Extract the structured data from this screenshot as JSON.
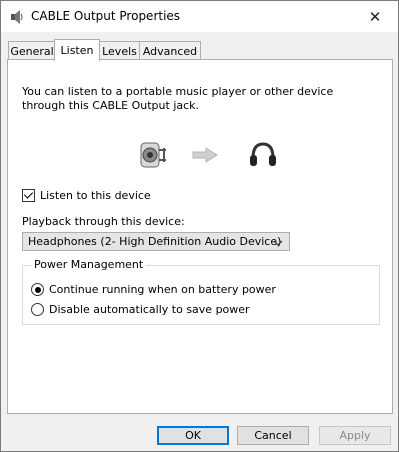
{
  "window": {
    "title": "CABLE Output Properties"
  },
  "tabs": [
    {
      "label": "General",
      "active": false
    },
    {
      "label": "Listen",
      "active": true
    },
    {
      "label": "Levels",
      "active": false
    },
    {
      "label": "Advanced",
      "active": false
    }
  ],
  "listen": {
    "description": "You can listen to a portable music player or other device through this CABLE Output jack.",
    "checkbox_label": "Listen to this device",
    "checkbox_checked": true,
    "playback_label": "Playback through this device:",
    "playback_selected": "Headphones (2- High Definition Audio Device)"
  },
  "power": {
    "title": "Power Management",
    "option_continue": "Continue running when on battery power",
    "option_disable": "Disable automatically to save power",
    "selected": "continue"
  },
  "buttons": {
    "ok": "OK",
    "cancel": "Cancel",
    "apply": "Apply"
  },
  "icons": {
    "app": "speaker-icon",
    "source": "cable-device-icon",
    "arrow": "arrow-right-icon",
    "target": "headphones-icon"
  },
  "colors": {
    "accent": "#0078d7",
    "window_bg": "#f0f0f0",
    "panel_bg": "#ffffff"
  }
}
